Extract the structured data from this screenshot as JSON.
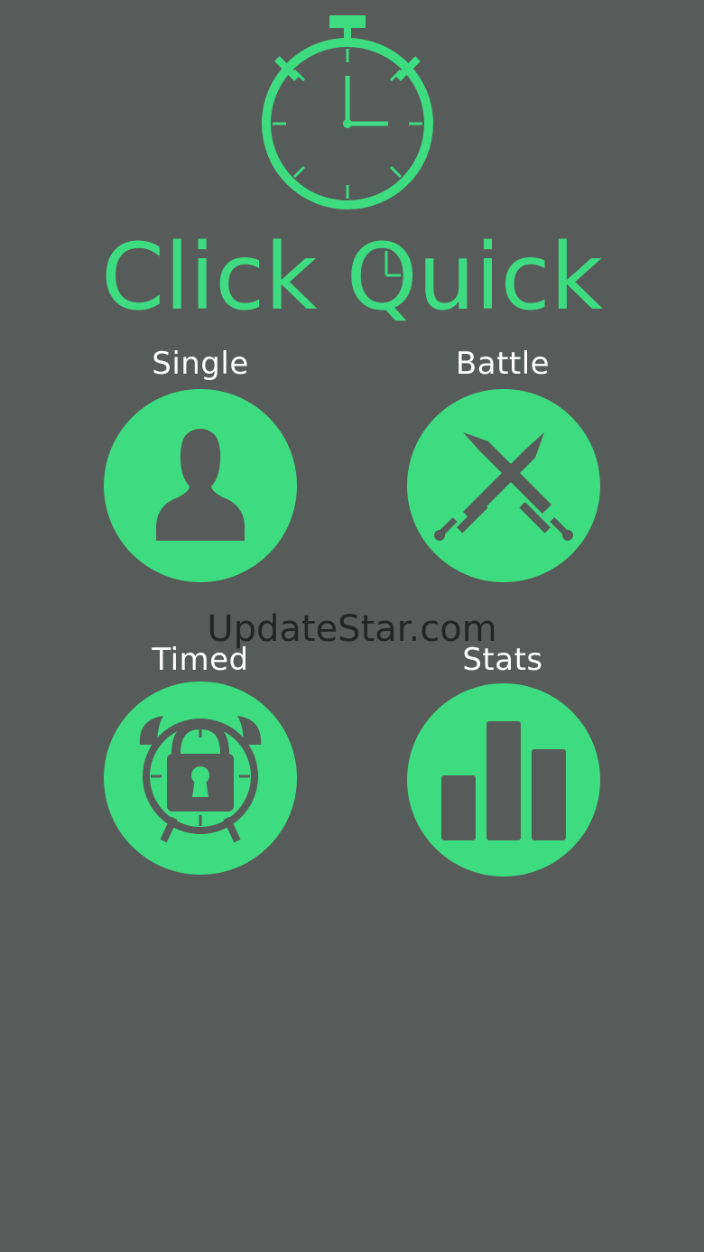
{
  "app": {
    "title": "Click Quick",
    "accent_color": "#3edc81",
    "background_color": "#575b59"
  },
  "menu": {
    "items": [
      {
        "id": "single",
        "label": "Single",
        "icon": "person-icon"
      },
      {
        "id": "battle",
        "label": "Battle",
        "icon": "crossed-swords-icon"
      },
      {
        "id": "timed",
        "label": "Timed",
        "icon": "alarm-clock-lock-icon"
      },
      {
        "id": "stats",
        "label": "Stats",
        "icon": "bar-chart-icon"
      }
    ]
  },
  "watermark": {
    "text": "UpdateStar.com"
  }
}
